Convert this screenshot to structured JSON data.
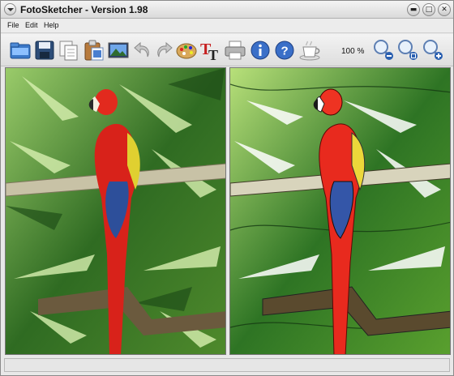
{
  "window": {
    "title": "FotoSketcher - Version 1.98"
  },
  "menu": {
    "file": "File",
    "edit": "Edit",
    "help": "Help"
  },
  "toolbar": {
    "zoom_level": "100 %"
  },
  "window_buttons": {
    "minimize": "▬",
    "maximize": "□",
    "close": "✕"
  },
  "status": {
    "text": ""
  },
  "panes": {
    "original": {
      "subject": "scarlet-macaw-photo"
    },
    "sketch": {
      "subject": "scarlet-macaw-painting"
    }
  }
}
